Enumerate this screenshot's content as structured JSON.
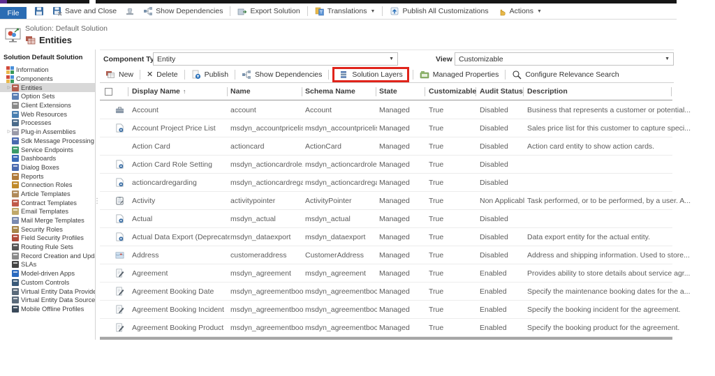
{
  "window": {
    "file_tab": "File",
    "ribbon_items": [
      {
        "name": "save-button",
        "icon": "save",
        "label": ""
      },
      {
        "name": "save-and-close-button",
        "icon": "save-close",
        "label": "Save and Close"
      },
      {
        "name": "stamp-button",
        "icon": "stamp",
        "label": ""
      },
      {
        "name": "show-dependencies-button",
        "icon": "dependencies",
        "label": "Show Dependencies"
      },
      {
        "sep": true
      },
      {
        "name": "export-solution-button",
        "icon": "export",
        "label": "Export Solution"
      },
      {
        "sep": true
      },
      {
        "name": "translations-menu",
        "icon": "translations",
        "label": "Translations",
        "caret": true
      },
      {
        "sep": true
      },
      {
        "name": "publish-all-customizations-button",
        "icon": "publish-all",
        "label": "Publish All Customizations"
      },
      {
        "name": "actions-menu",
        "icon": "hand",
        "label": "Actions",
        "caret": true
      }
    ]
  },
  "header": {
    "solution_label": "Solution: Default Solution",
    "page_title": "Entities"
  },
  "sidebar": {
    "title": "Solution Default Solution",
    "items": [
      {
        "label": "Information",
        "icon_color": "multi",
        "indent": 0
      },
      {
        "label": "Components",
        "icon_color": "multi",
        "indent": 0
      },
      {
        "label": "Entities",
        "icon_color": "#b25b4d",
        "indent": 1,
        "selected": true,
        "expander": true
      },
      {
        "label": "Option Sets",
        "icon_color": "#5b7fb4",
        "indent": 1
      },
      {
        "label": "Client Extensions",
        "icon_color": "#8a8a8a",
        "indent": 1
      },
      {
        "label": "Web Resources",
        "icon_color": "#4a7fb0",
        "indent": 1
      },
      {
        "label": "Processes",
        "icon_color": "#4a6a8a",
        "indent": 1
      },
      {
        "label": "Plug-in Assemblies",
        "icon_color": "#9a9aa8",
        "indent": 1,
        "expander": true
      },
      {
        "label": "Sdk Message Processing St...",
        "icon_color": "#4a6ab0",
        "indent": 1
      },
      {
        "label": "Service Endpoints",
        "icon_color": "#3a9a6a",
        "indent": 1
      },
      {
        "label": "Dashboards",
        "icon_color": "#3a6ab8",
        "indent": 1
      },
      {
        "label": "Dialog Boxes",
        "icon_color": "#4a6ab0",
        "indent": 1
      },
      {
        "label": "Reports",
        "icon_color": "#b07a3a",
        "indent": 1
      },
      {
        "label": "Connection Roles",
        "icon_color": "#c08a2a",
        "indent": 1
      },
      {
        "label": "Article Templates",
        "icon_color": "#b08a5a",
        "indent": 1
      },
      {
        "label": "Contract Templates",
        "icon_color": "#c05a4a",
        "indent": 1
      },
      {
        "label": "Email Templates",
        "icon_color": "#c0a86a",
        "indent": 1
      },
      {
        "label": "Mail Merge Templates",
        "icon_color": "#7a8ab0",
        "indent": 1
      },
      {
        "label": "Security Roles",
        "icon_color": "#a8864a",
        "indent": 1
      },
      {
        "label": "Field Security Profiles",
        "icon_color": "#b04a3a",
        "indent": 1
      },
      {
        "label": "Routing Rule Sets",
        "icon_color": "#555555",
        "indent": 1
      },
      {
        "label": "Record Creation and Upda...",
        "icon_color": "#8a8a8a",
        "indent": 1
      },
      {
        "label": "SLAs",
        "icon_color": "#444444",
        "indent": 1
      },
      {
        "label": "Model-driven Apps",
        "icon_color": "#2a6ac0",
        "indent": 1
      },
      {
        "label": "Custom Controls",
        "icon_color": "#3a5a7a",
        "indent": 1
      },
      {
        "label": "Virtual Entity Data Providers",
        "icon_color": "#5a6a7a",
        "indent": 1
      },
      {
        "label": "Virtual Entity Data Sources",
        "icon_color": "#5a6a7a",
        "indent": 1
      },
      {
        "label": "Mobile Offline Profiles",
        "icon_color": "#3a4a5a",
        "indent": 1
      }
    ]
  },
  "filters": {
    "component_type_label": "Component Type",
    "component_type_value": "Entity",
    "view_label": "View",
    "view_value": "Customizable"
  },
  "grid_toolbar": {
    "highlight_color": "#e0241b",
    "items": [
      {
        "name": "new-button",
        "icon": "new",
        "label": "New"
      },
      {
        "sep": true
      },
      {
        "name": "delete-button",
        "icon": "delete",
        "label": "Delete"
      },
      {
        "sep": true
      },
      {
        "name": "publish-button",
        "icon": "publish",
        "label": "Publish"
      },
      {
        "sep": true
      },
      {
        "name": "show-dependencies-grid-button",
        "icon": "dependencies",
        "label": "Show Dependencies"
      },
      {
        "sep": true
      },
      {
        "name": "solution-layers-button",
        "icon": "layers",
        "label": "Solution Layers",
        "highlighted": true
      },
      {
        "sep": true
      },
      {
        "name": "managed-properties-button",
        "icon": "managed",
        "label": "Managed Properties"
      },
      {
        "sep": true
      },
      {
        "name": "configure-relevance-search-button",
        "icon": "search",
        "label": "Configure Relevance Search"
      }
    ]
  },
  "table": {
    "sort_column": "Display Name",
    "sort_direction": "asc",
    "columns": [
      "Display Name",
      "Name",
      "Schema Name",
      "State",
      "Customizable",
      "Audit Status",
      "Description"
    ],
    "rows": [
      {
        "icon": "briefcase",
        "display_name": "Account",
        "name": "account",
        "schema_name": "Account",
        "state": "Managed",
        "customizable": "True",
        "audit_status": "Disabled",
        "description": "Business that represents a customer or potential..."
      },
      {
        "icon": "doc-gear",
        "display_name": "Account Project Price List",
        "name": "msdyn_accountpricelist",
        "schema_name": "msdyn_accountpricelist",
        "state": "Managed",
        "customizable": "True",
        "audit_status": "Disabled",
        "description": "Sales price list for this customer to capture speci..."
      },
      {
        "icon": "none",
        "display_name": "Action Card",
        "name": "actioncard",
        "schema_name": "ActionCard",
        "state": "Managed",
        "customizable": "True",
        "audit_status": "Disabled",
        "description": "Action card entity to show action cards."
      },
      {
        "icon": "doc-gear",
        "display_name": "Action Card Role Setting",
        "name": "msdyn_actioncardrole...",
        "schema_name": "msdyn_actioncardrole...",
        "state": "Managed",
        "customizable": "True",
        "audit_status": "Disabled",
        "description": ""
      },
      {
        "icon": "doc-gear",
        "display_name": "actioncardregarding",
        "name": "msdyn_actioncardrega...",
        "schema_name": "msdyn_actioncardrega...",
        "state": "Managed",
        "customizable": "True",
        "audit_status": "Disabled",
        "description": ""
      },
      {
        "icon": "clipboard",
        "display_name": "Activity",
        "name": "activitypointer",
        "schema_name": "ActivityPointer",
        "state": "Managed",
        "customizable": "True",
        "audit_status": "Non Applicable",
        "description": "Task performed, or to be performed, by a user. A..."
      },
      {
        "icon": "doc-gear",
        "display_name": "Actual",
        "name": "msdyn_actual",
        "schema_name": "msdyn_actual",
        "state": "Managed",
        "customizable": "True",
        "audit_status": "Disabled",
        "description": ""
      },
      {
        "icon": "doc-gear",
        "display_name": "Actual Data Export (Deprecated)",
        "name": "msdyn_dataexport",
        "schema_name": "msdyn_dataexport",
        "state": "Managed",
        "customizable": "True",
        "audit_status": "Disabled",
        "description": "Data export entity for the actual entity."
      },
      {
        "icon": "map",
        "display_name": "Address",
        "name": "customeraddress",
        "schema_name": "CustomerAddress",
        "state": "Managed",
        "customizable": "True",
        "audit_status": "Disabled",
        "description": "Address and shipping information. Used to store..."
      },
      {
        "icon": "doc-edit",
        "display_name": "Agreement",
        "name": "msdyn_agreement",
        "schema_name": "msdyn_agreement",
        "state": "Managed",
        "customizable": "True",
        "audit_status": "Enabled",
        "description": "Provides ability to store details about service agr..."
      },
      {
        "icon": "doc-edit",
        "display_name": "Agreement Booking Date",
        "name": "msdyn_agreementboo...",
        "schema_name": "msdyn_agreementboo...",
        "state": "Managed",
        "customizable": "True",
        "audit_status": "Enabled",
        "description": "Specify the maintenance booking dates for the a..."
      },
      {
        "icon": "doc-edit",
        "display_name": "Agreement Booking Incident",
        "name": "msdyn_agreementboo...",
        "schema_name": "msdyn_agreementboo...",
        "state": "Managed",
        "customizable": "True",
        "audit_status": "Enabled",
        "description": "Specify the booking incident for the agreement."
      },
      {
        "icon": "doc-edit",
        "display_name": "Agreement Booking Product",
        "name": "msdyn_agreementboo...",
        "schema_name": "msdyn_agreementboo...",
        "state": "Managed",
        "customizable": "True",
        "audit_status": "Enabled",
        "description": "Specify the booking product for the agreement."
      }
    ]
  }
}
